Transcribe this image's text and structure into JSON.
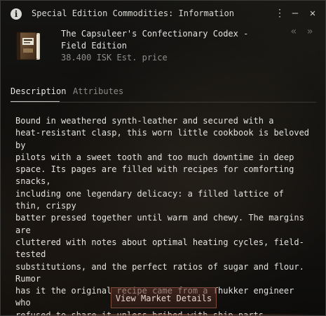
{
  "window": {
    "title": "Special Edition Commodities: Information"
  },
  "controls": {
    "menu_glyph": "⋮",
    "minimize_glyph": "—",
    "close_glyph": "✕",
    "info_glyph": "i"
  },
  "item": {
    "name": "The Capsuleer's Confectionary Codex - Field Edition",
    "price": "38.400 ISK Est. price",
    "icon": "book-icon"
  },
  "nav": {
    "back_glyph": "«",
    "forward_glyph": "»"
  },
  "tabs": [
    {
      "label": "Description",
      "active": true
    },
    {
      "label": "Attributes",
      "active": false
    }
  ],
  "description": "Bound in weathered synth-leather and secured with a\nheat-resistant clasp, this worn little cookbook is beloved by\npilots with a sweet tooth and too much downtime in deep\nspace. Its pages are filled with recipes for comforting snacks,\nincluding one legendary delicacy: a filled lattice of thin, crispy\nbatter pressed together until warm and chewy. The margins are\ncluttered with notes about optimal heating cycles, field-tested\nsubstitutions, and the perfect ratios of sugar and flour. Rumor\nhas it the original recipe came from a Thukker engineer who\nrefused to share it unless bribed with ship parts.",
  "actions": {
    "market_button": "View Market Details"
  },
  "colors": {
    "accent": "#7a4a3a",
    "text": "#e2e2df",
    "muted": "#8d8d8a"
  }
}
